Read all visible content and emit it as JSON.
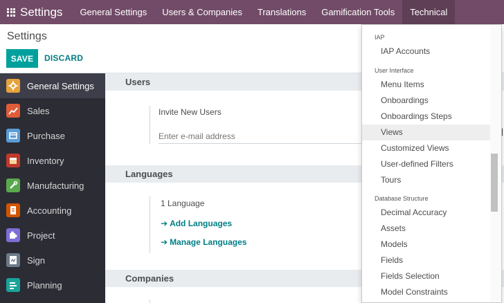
{
  "topbar": {
    "brand": "Settings",
    "menu": [
      "General Settings",
      "Users & Companies",
      "Translations",
      "Gamification Tools",
      "Technical"
    ]
  },
  "control": {
    "title": "Settings",
    "save": "SAVE",
    "discard": "DISCARD"
  },
  "sidebar": {
    "items": [
      {
        "label": "General Settings",
        "icon": "gear-icon",
        "color": "#e6a23c"
      },
      {
        "label": "Sales",
        "icon": "chart-icon",
        "color": "#e05c38"
      },
      {
        "label": "Purchase",
        "icon": "cart-icon",
        "color": "#5b9bd5"
      },
      {
        "label": "Inventory",
        "icon": "box-icon",
        "color": "#c0392b"
      },
      {
        "label": "Manufacturing",
        "icon": "wrench-icon",
        "color": "#5aa84d"
      },
      {
        "label": "Accounting",
        "icon": "invoice-icon",
        "color": "#d35400"
      },
      {
        "label": "Project",
        "icon": "puzzle-icon",
        "color": "#7b6fd6"
      },
      {
        "label": "Sign",
        "icon": "sign-icon",
        "color": "#6c7a89"
      },
      {
        "label": "Planning",
        "icon": "planning-icon",
        "color": "#1aa39a"
      }
    ]
  },
  "main": {
    "users": {
      "heading": "Users",
      "invite_label": "Invite New Users",
      "email_placeholder": "Enter e-mail address"
    },
    "languages": {
      "heading": "Languages",
      "count": "1 Language",
      "add": "Add Languages",
      "manage": "Manage Languages"
    },
    "companies": {
      "heading": "Companies"
    }
  },
  "dropdown": {
    "iap_header": "IAP",
    "iap_items": [
      "IAP Accounts"
    ],
    "ui_header": "User Interface",
    "ui_items": [
      "Menu Items",
      "Onboardings",
      "Onboardings Steps",
      "Views",
      "Customized Views",
      "User-defined Filters",
      "Tours"
    ],
    "db_header": "Database Structure",
    "db_items": [
      "Decimal Accuracy",
      "Assets",
      "Models",
      "Fields",
      "Fields Selection",
      "Model Constraints"
    ]
  },
  "colors": {
    "topbar": "#714b67",
    "accent": "#00a09d",
    "link": "#017e84",
    "sidebar": "#2c2c35"
  }
}
